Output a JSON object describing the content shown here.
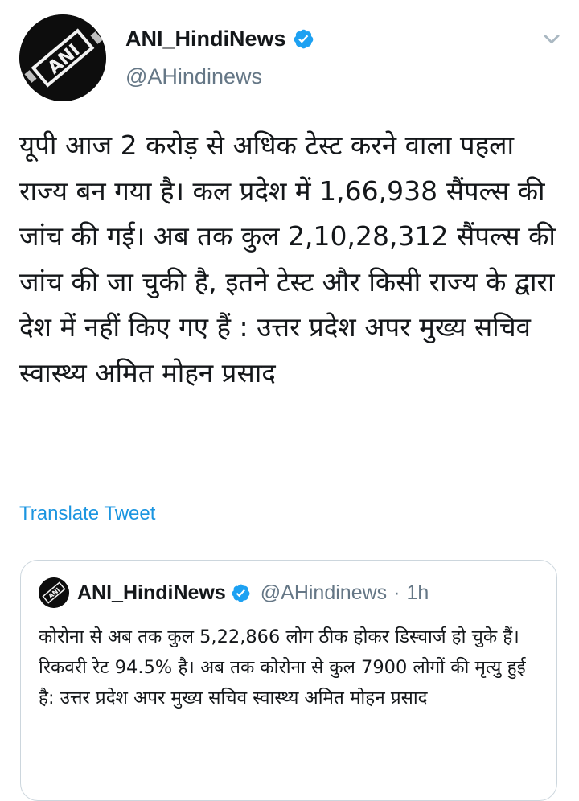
{
  "tweet": {
    "author": {
      "name": "ANI_HindiNews",
      "handle": "@AHindinews",
      "avatar_icon": "ani-logo-icon",
      "verified_icon": "verified-badge-icon"
    },
    "menu_icon": "chevron-down-icon",
    "text": "यूपी आज 2 करोड़ से अधिक टेस्ट करने वाला पहला राज्य बन गया है। कल प्रदेश में 1,66,938 सैंपल्स की जांच की गई। अब तक कुल 2,10,28,312 सैंपल्स की जांच की जा चुकी है, इतने टेस्ट और किसी राज्य के द्वारा देश में नहीं किए गए हैं : उत्तर प्रदेश अपर मुख्य सचिव स्वास्थ्य अमित मोहन प्रसाद",
    "translate_label": "Translate Tweet"
  },
  "quoted_tweet": {
    "author": {
      "name": "ANI_HindiNews",
      "handle": "@AHindinews",
      "avatar_icon": "ani-logo-icon",
      "verified_icon": "verified-badge-icon"
    },
    "separator": "·",
    "time": "1h",
    "text": "कोरोना से अब तक कुल 5,22,866 लोग ठीक होकर डिस्चार्ज हो चुके हैं। रिकवरी रेट 94.5% है। अब तक कोरोना से कुल 7900 लोगों की मृत्यु हुई है: उत्तर प्रदेश अपर मुख्य सचिव स्वास्थ्य अमित मोहन प्रसाद"
  },
  "colors": {
    "link": "#1b95e0",
    "verified": "#1da1f2",
    "secondary_text": "#657786",
    "border": "#ccd6dd"
  }
}
